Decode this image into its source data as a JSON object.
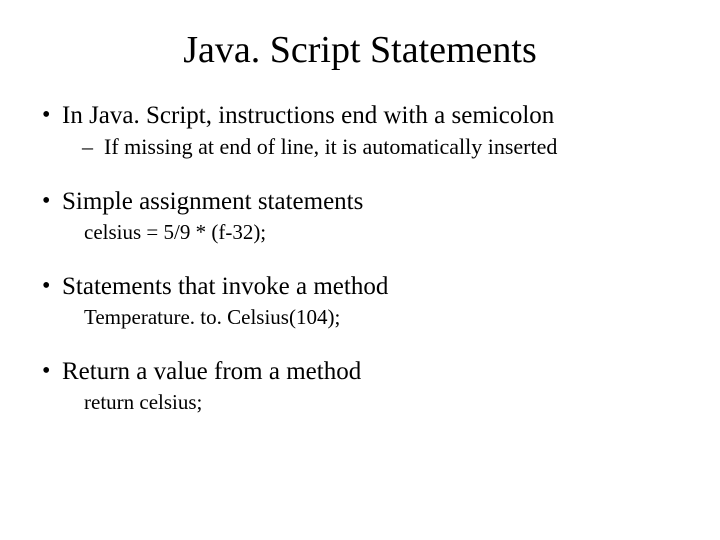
{
  "title": "Java. Script Statements",
  "bullets": [
    {
      "text": "In Java. Script, instructions end with a semicolon",
      "sub": "If missing at end of line, it is automatically inserted"
    },
    {
      "text": "Simple assignment statements",
      "code": "celsius = 5/9 * (f-32);"
    },
    {
      "text": "Statements that invoke a method",
      "code": "Temperature. to. Celsius(104);"
    },
    {
      "text": "Return a value from a method",
      "code": "return celsius;"
    }
  ]
}
